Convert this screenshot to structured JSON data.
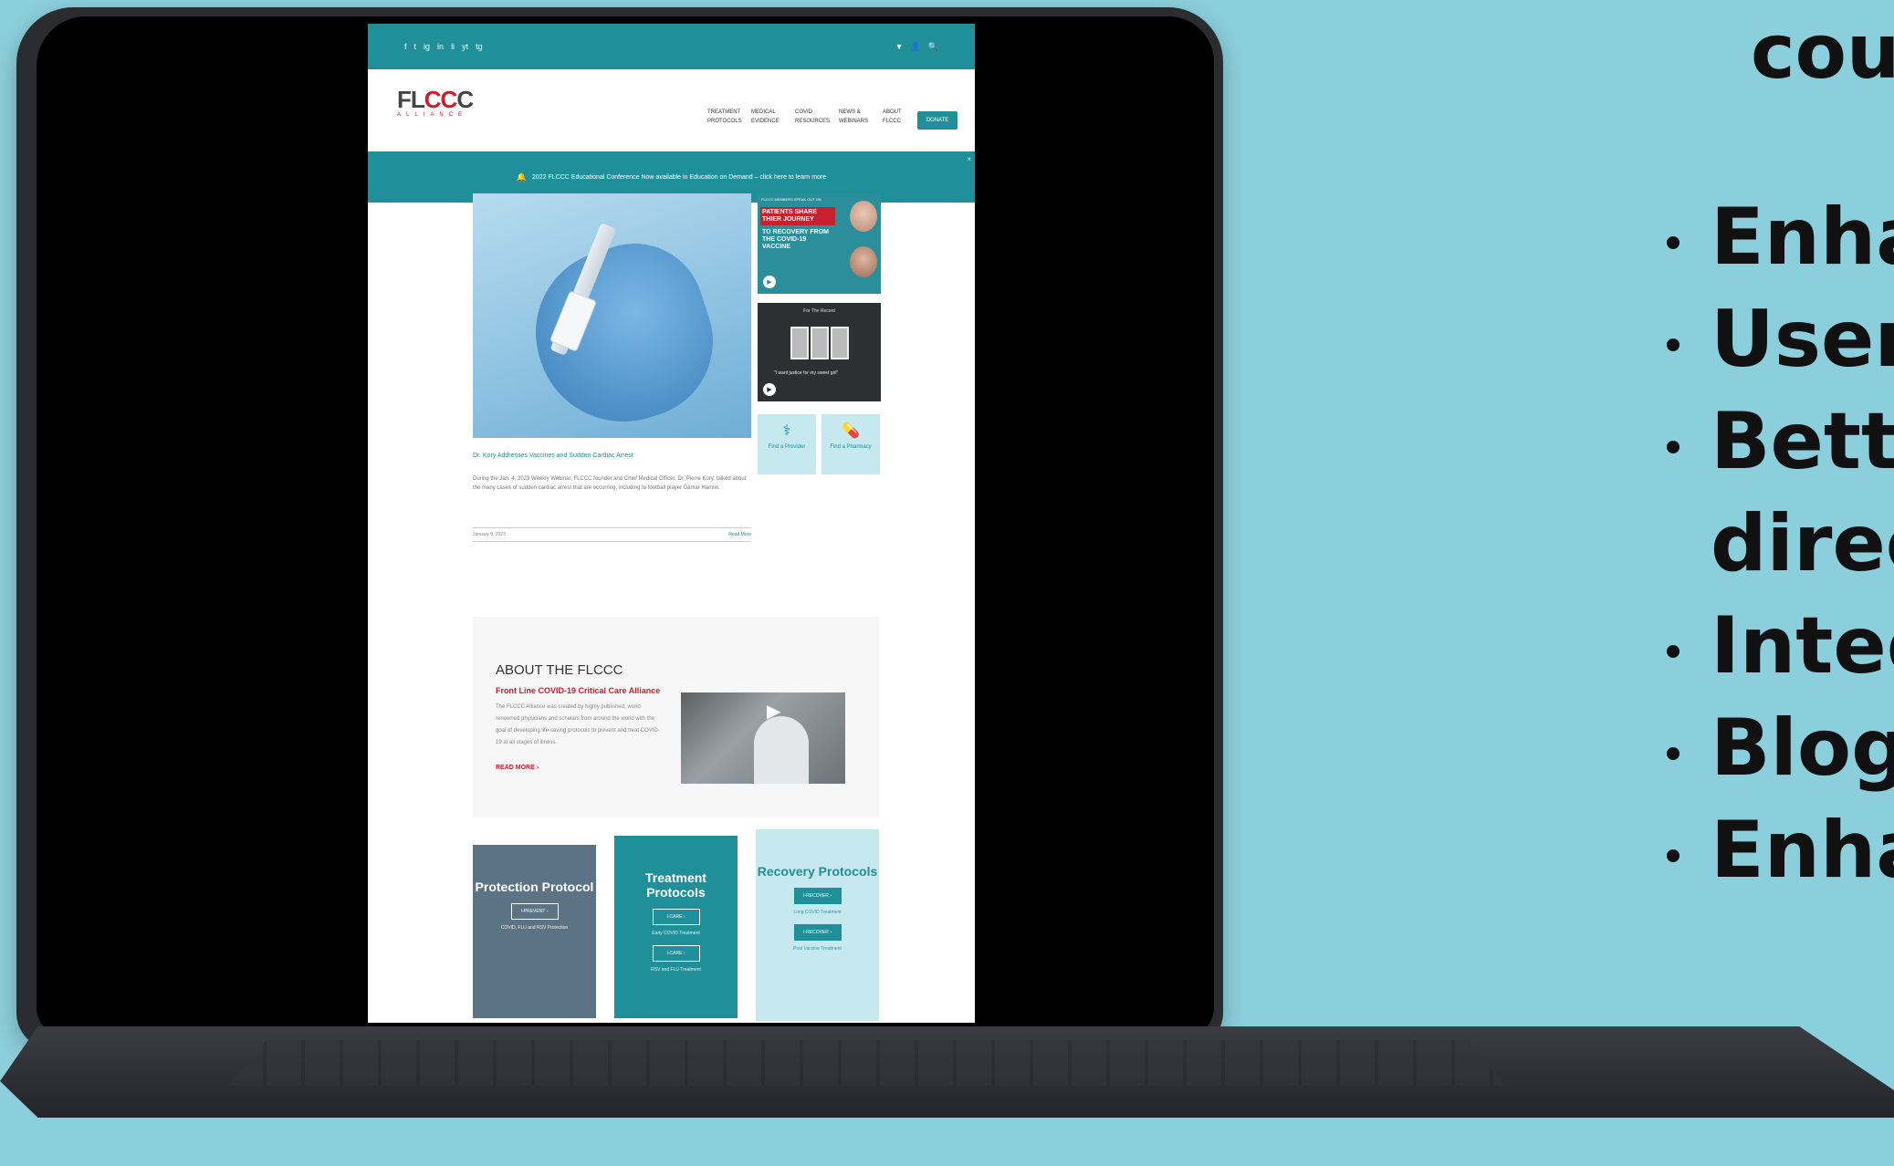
{
  "site": {
    "topbar": {
      "social": [
        "f",
        "t",
        "ig",
        "in",
        "li",
        "yt",
        "tg"
      ],
      "tools": [
        "▼",
        "👤",
        "🔍"
      ]
    },
    "logo": {
      "main_part1": "FL",
      "main_part2": "CC",
      "main_part3": "C",
      "sub": "ALLIANCE"
    },
    "nav": [
      {
        "label": "TREATMENT PROTOCOLS"
      },
      {
        "label": "MEDICAL EVIDENCE"
      },
      {
        "label": "COVID RESOURCES"
      },
      {
        "label": "NEWS & WEBINARS"
      },
      {
        "label": "ABOUT FLCCC"
      }
    ],
    "donate_label": "DONATE",
    "announcement": {
      "text": "2022 FLCCC Educational Conference Now available in Education on Demand – click here to learn more",
      "close": "×"
    },
    "feature": {
      "title": "Dr. Kory Addresses Vaccines and Sudden Cardiac Arrest",
      "excerpt": "During the Jan. 4, 2023 Weekly Webinar, FLCCC founder and Chief Medical Officer, Dr. Pierre Kory, talked about the many cases of sudden cardiac arrest that are occurring, including to football player Damar Hamlin.",
      "date": "January 9, 2023",
      "read_more": "Read More"
    },
    "side_card1": {
      "top": "FLCCC MEMBERS SPEAK OUT ON",
      "red_label": "PATIENTS SHARE THIER JOURNEY",
      "white_label": "TO RECOVERY FROM THE COVID-19 VACCINE"
    },
    "side_card2": {
      "caption": "For The Record",
      "quote": "\"I want justice for my sweet girl\""
    },
    "find_provider": "Find a Provider",
    "find_pharmacy": "Find a Pharmacy",
    "about": {
      "title": "ABOUT THE FLCCC",
      "subtitle": "Front Line COVID-19 Critical Care Alliance",
      "text": "The FLCCC Alliance was created by highly published, world renowned physicians and scholars from around the world with the goal of developing life-saving protocols to prevent and treat COVID-19 at all stages of illness.",
      "read_more": "READ MORE ›"
    },
    "protocols": [
      {
        "title": "Protection Protocol",
        "btn1": "I-PREVENT ›",
        "note1": "COVID, FLU and RSV Protection"
      },
      {
        "title": "Treatment Protocols",
        "btn1": "I-CARE ›",
        "note1": "Early COVID Treatment",
        "btn2": "I-CARE ›",
        "note2": "RSV and FLU Treatment"
      },
      {
        "title": "Recovery Protocols",
        "btn1": "I-RECOVER ›",
        "note1": "Long COVID Treatment",
        "btn2": "I-RECOVER ›",
        "note2": "Post Vaccine Treatment"
      }
    ]
  },
  "right_panel": {
    "title": "cou",
    "items": [
      "Enha",
      "User",
      "Bette",
      "direc",
      "Integ",
      "Blog",
      "Enha"
    ]
  },
  "colors": {
    "background": "#8ccfdc",
    "teal": "#1f8f99",
    "red": "#c8202c",
    "laptop": "#2b2c30"
  }
}
